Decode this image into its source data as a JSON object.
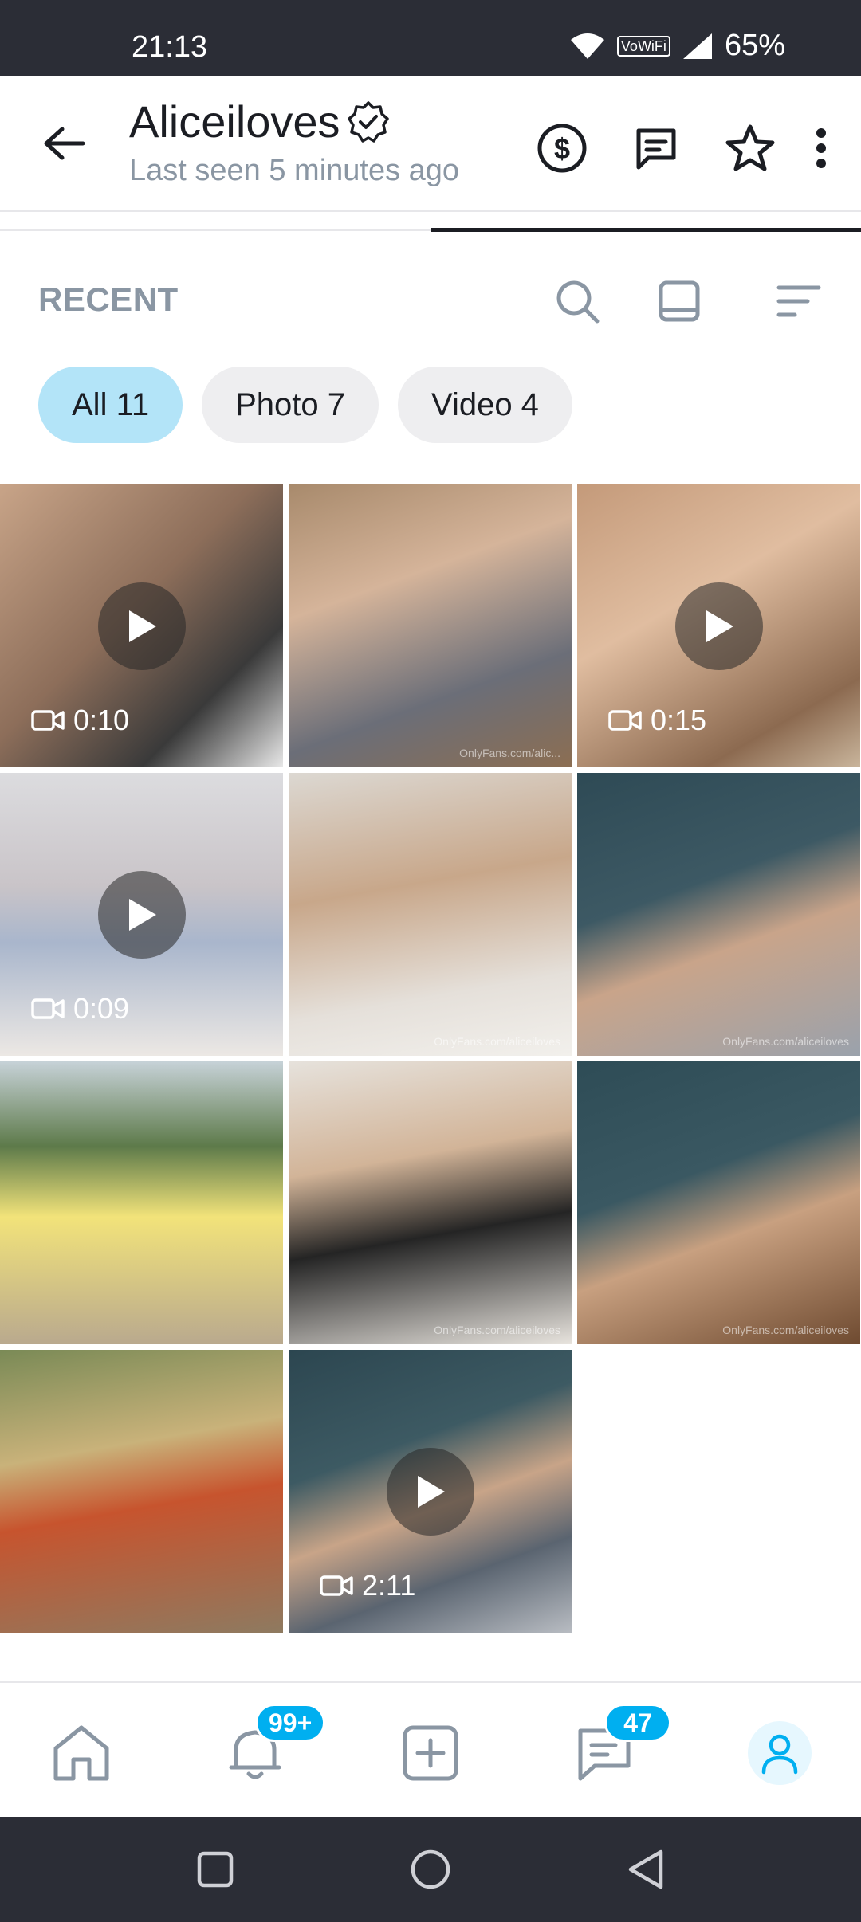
{
  "status_bar": {
    "time": "21:13",
    "network": "VoWiFi",
    "battery": "65%"
  },
  "header": {
    "title": "Aliceiloves",
    "subtitle": "Last seen 5 minutes ago",
    "icons": [
      "dollar-circle-icon",
      "message-icon",
      "star-icon",
      "more-vertical-icon"
    ]
  },
  "section": {
    "label": "RECENT"
  },
  "chips": [
    {
      "label": "All 11",
      "active": true
    },
    {
      "label": "Photo 7",
      "active": false
    },
    {
      "label": "Video 4",
      "active": false
    }
  ],
  "media": [
    {
      "type": "video",
      "duration": "0:10"
    },
    {
      "type": "photo",
      "watermark": "OnlyFans.com/alic..."
    },
    {
      "type": "video",
      "duration": "0:15"
    },
    {
      "type": "video",
      "duration": "0:09"
    },
    {
      "type": "photo",
      "watermark": "OnlyFans.com/aliceiloves"
    },
    {
      "type": "photo",
      "watermark": "OnlyFans.com/aliceiloves"
    },
    {
      "type": "photo",
      "watermark": ""
    },
    {
      "type": "photo",
      "watermark": "OnlyFans.com/aliceiloves"
    },
    {
      "type": "photo",
      "watermark": "OnlyFans.com/aliceiloves"
    },
    {
      "type": "photo",
      "watermark": ""
    },
    {
      "type": "video",
      "duration": "2:11"
    }
  ],
  "bottom_nav": {
    "notifications_badge": "99+",
    "messages_badge": "47"
  },
  "colors": {
    "accent": "#00aff0",
    "chip_active": "#b3e4f8",
    "muted": "#8a96a3",
    "bars": "#2b2d36"
  }
}
